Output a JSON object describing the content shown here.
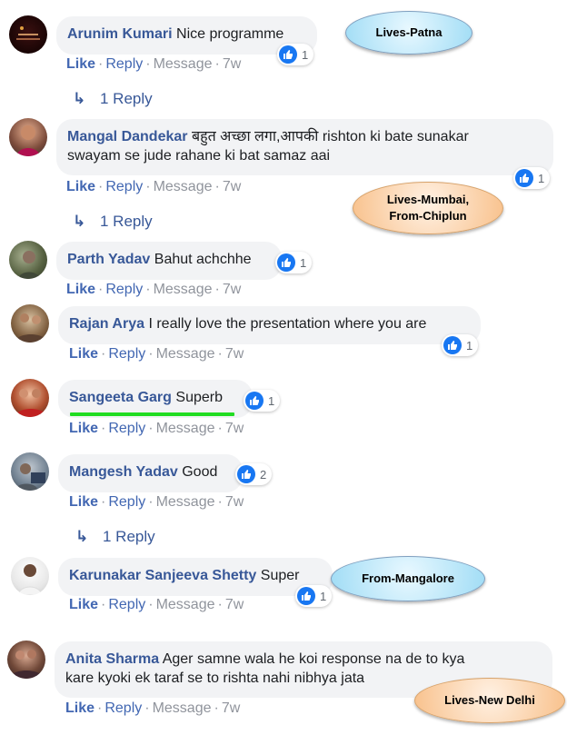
{
  "actions": {
    "like": "Like",
    "reply": "Reply",
    "message": "Message",
    "separator": "·"
  },
  "comments": [
    {
      "name": "Arunim Kumari",
      "text": "Nice programme",
      "text2": "",
      "time": "7w",
      "likes": "1"
    },
    {
      "name": "Mangal Dandekar",
      "text": "बहुत अच्छा लगा,आपकी rishton ki bate sunakar",
      "text2": "swayam se jude rahane ki bat samaz aai",
      "time": "7w",
      "likes": "1"
    },
    {
      "name": "Parth Yadav",
      "text": "Bahut achchhe",
      "text2": "",
      "time": "7w",
      "likes": "1"
    },
    {
      "name": "Rajan Arya",
      "text": "I really love the presentation where you are",
      "text2": "",
      "time": "7w",
      "likes": "1"
    },
    {
      "name": "Sangeeta Garg",
      "text": "Superb",
      "text2": "",
      "time": "7w",
      "likes": "1"
    },
    {
      "name": "Mangesh Yadav",
      "text": "Good",
      "text2": "",
      "time": "7w",
      "likes": "2"
    },
    {
      "name": "Karunakar Sanjeeva Shetty",
      "text": "Super",
      "text2": "",
      "time": "7w",
      "likes": "1"
    },
    {
      "name": "Anita Sharma",
      "text": "Ager samne wala he koi response na de to kya",
      "text2": "kare kyoki ek taraf se to rishta nahi nibhya jata",
      "time": "7w",
      "likes": ""
    }
  ],
  "replies": {
    "label": "1 Reply"
  },
  "callouts": {
    "patna": "Lives-Patna",
    "mumbai_l1": "Lives-Mumbai,",
    "mumbai_l2": "From-Chiplun",
    "mangalore": "From-Mangalore",
    "delhi": "Lives-New Delhi"
  },
  "colors": {
    "name_link": "#385898",
    "like_blue": "#1877f2",
    "bubble_bg": "#f2f3f5",
    "highlight_underline": "#22dd22"
  },
  "icons": [
    "like-thumb-icon",
    "reply-arrow-icon"
  ]
}
